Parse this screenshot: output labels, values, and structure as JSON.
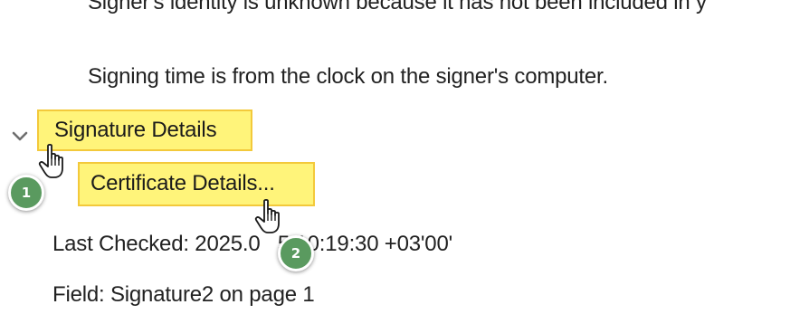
{
  "lines": {
    "cut_off_text": "Signer's identity is unknown because it has not been included in y",
    "signing_time": "Signing time is from the clock on the signer's computer.",
    "last_checked": "Last Checked: 2025.0   5 10:19:30 +03'00'",
    "field": "Field: Signature2 on page 1"
  },
  "signature_details": {
    "label": "Signature Details",
    "expanded": true,
    "toggle_icon": "chevron-down-icon"
  },
  "certificate_details": {
    "label": "Certificate Details..."
  },
  "annotations": {
    "step_1": "1",
    "step_2": "2"
  },
  "colors": {
    "highlight_fill": "#fff47a",
    "highlight_border": "#f3c93b",
    "badge_fill": "#5a9a5f"
  },
  "icons": {
    "cursor": "hand-pointer-icon"
  }
}
